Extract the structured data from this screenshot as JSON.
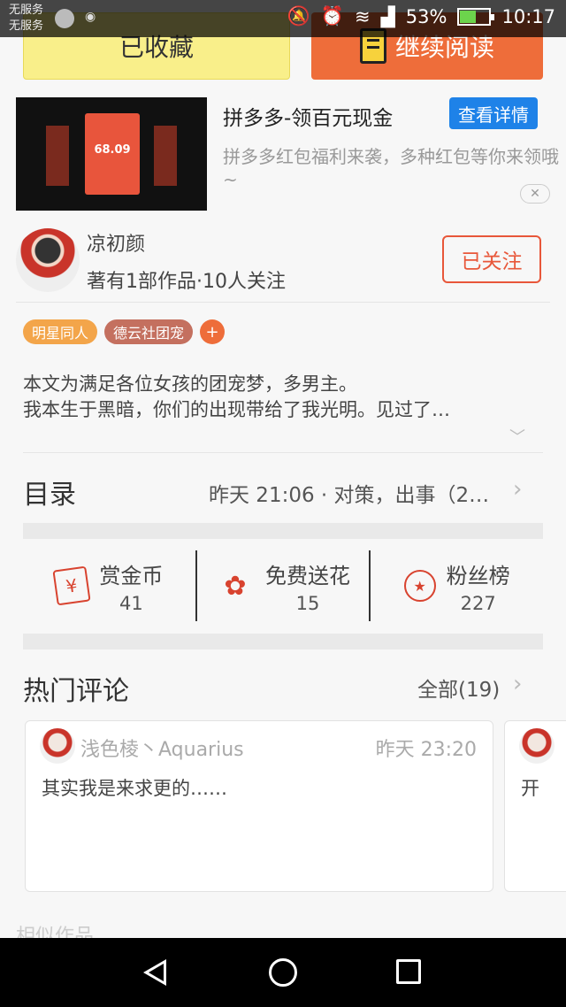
{
  "status_bar": {
    "carrier1": "无服务",
    "carrier2": "无服务",
    "battery": "53%",
    "time": "10:17"
  },
  "actions": {
    "favorited_label": "已收藏",
    "continue_label": "继续阅读"
  },
  "ad": {
    "title": "拼多多-领百元现金",
    "detail_label": "查看详情",
    "description": "拼多多红包福利来袭，多种红包等你来领哦~",
    "amount": "68.09",
    "close_label": "✕"
  },
  "author": {
    "name": "凉初颜",
    "meta": "著有1部作品·10人关注",
    "follow_label": "已关注"
  },
  "tags": [
    "明星同人",
    "德云社团宠"
  ],
  "tag_add": "+",
  "synopsis": {
    "line1": "本文为满足各位女孩的团宠梦，多男主。",
    "line2": "我本生于黑暗，你们的出现带给了我光明。见过了…"
  },
  "catalog": {
    "title": "目录",
    "latest": "昨天 21:06 · 对策，出事（2…"
  },
  "stats": [
    {
      "label": "赏金币",
      "value": "41",
      "icon": "money-icon"
    },
    {
      "label": "免费送花",
      "value": "15",
      "icon": "flower-icon"
    },
    {
      "label": "粉丝榜",
      "value": "227",
      "icon": "medal-icon"
    }
  ],
  "comments": {
    "title": "热门评论",
    "all_label": "全部(19)",
    "items": [
      {
        "user": "浅色棱丶Aquarius",
        "time": "昨天 23:20",
        "text": "其实我是来求更的……"
      },
      {
        "text": "开"
      }
    ]
  },
  "similar_title": "相似作品"
}
